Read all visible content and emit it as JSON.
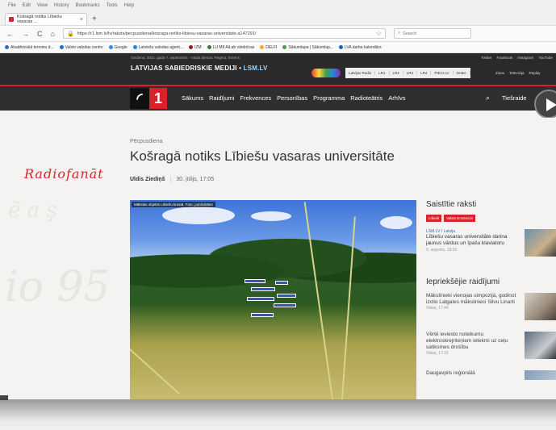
{
  "browser": {
    "menu": [
      "File",
      "Edit",
      "View",
      "History",
      "Bookmarks",
      "Tools",
      "Help"
    ],
    "tab_title": "Košragā notiks Lībiešu vasaras ...",
    "tab_close": "×",
    "new_tab": "+",
    "url": "https://r1.lsm.lv/lv/raksts/pecpusdiena/kosraga-notiks-libiesu-vasaras-universitate.a147291/",
    "search_placeholder": "Search",
    "nav": {
      "back": "←",
      "forward": "→",
      "reload": "C",
      "home": "⌂"
    },
    "bookmarks": [
      "Akadēmiskā terminu d...",
      "Valsts valodas centrs",
      "Google",
      "Latviešu valodas aģent...",
      "IZM",
      "LU MII AiLab vārdnīcas",
      "DELFI",
      "Sākumlapa | Sākumlap...",
      "LVA darba kalendārs"
    ]
  },
  "site": {
    "date": "Otrdiena, 2021. gada 7. septembris · Vārda dienas: Regīna, Ermīns",
    "brand_main": "LATVIJAS SABIEDRISKIE MEDIJI • ",
    "brand_lsm": "LSM.LV",
    "social": [
      "Twitter",
      "Facebook",
      "Instagram",
      "YouTube"
    ],
    "radios": [
      "Latvijas Radio",
      "LR1",
      "LR2",
      "LR3",
      "LR4",
      "PIECI.LV",
      "NABA"
    ],
    "rtv": [
      "Ziņas",
      "Televīzija",
      "Replay"
    ],
    "logo_digit": "1",
    "nav_links": [
      "Sākums",
      "Raidījumi",
      "Frekvences",
      "Personības",
      "Programma",
      "Radioteātris",
      "Arhīvs"
    ],
    "tiesraide": "Tiešraide"
  },
  "article": {
    "kicker": "Pēcpusdiena",
    "headline": "Košragā notiks Lībiešu vasaras universitāte",
    "author": "Uldis Ziediņš",
    "date": "30. jūlijs, 17:05",
    "photo_caption": "Mākslas objekts Lībiešu krastā. Foto: publicitātes"
  },
  "decor": {
    "radiofanat": "Radiofanāt"
  },
  "sidebar": {
    "related_title": "Saistītie raksti",
    "tags": [
      "Lībieši",
      "Valsts Ennēmcis"
    ],
    "related": [
      {
        "source": "LSM.LV / Latvija",
        "title": "Lībiešu vasaras universitāte darina jaunus vārdus un īpašu klaviatoru",
        "time": "9. augusts, 18:50"
      }
    ],
    "previous_title": "Iepriekšējie raidījumi",
    "previous": [
      {
        "title": "Mākslinieki vienojas simpozijā, godinot izcilo Latgales mākslinieci Silvu Linarti",
        "time": "Vakar, 17:44"
      },
      {
        "title": "Vērtē ieviesto noteikumu elektroskrejriteņiem ietekmi uz ceļu satiksmes drošību",
        "time": "Vakar, 17:15"
      },
      {
        "title": "Daugavpils reģionālā",
        "time": ""
      }
    ]
  }
}
